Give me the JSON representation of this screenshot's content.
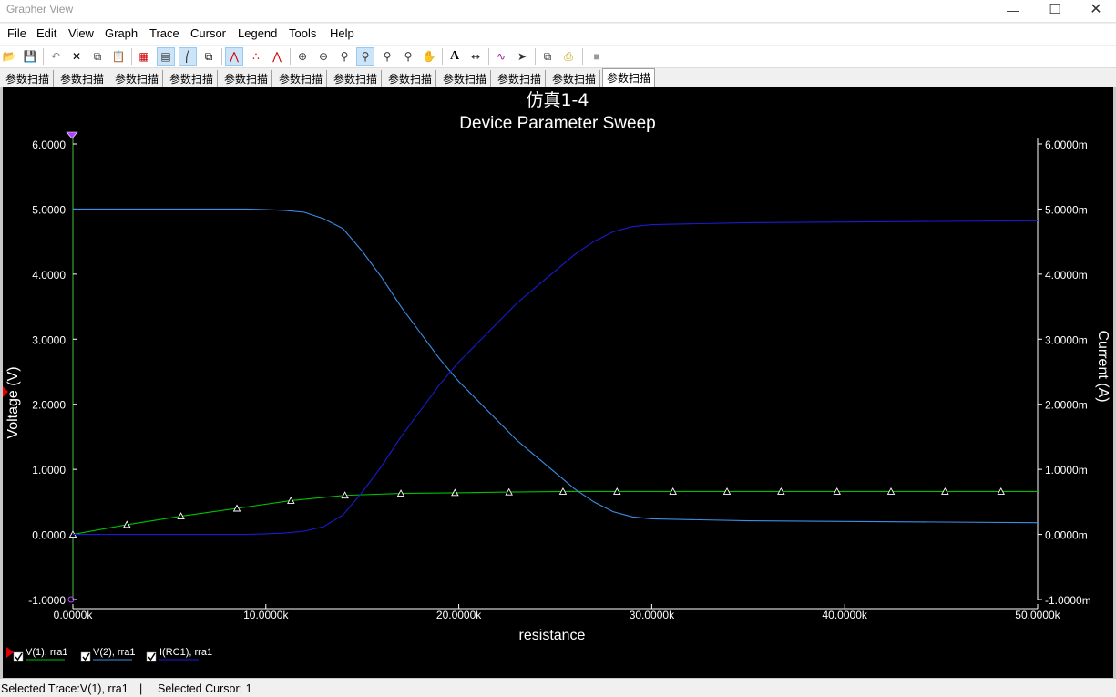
{
  "window": {
    "title": "Grapher View",
    "controls": {
      "minimize": "—",
      "maximize": "☐",
      "close": "✕"
    }
  },
  "menu": [
    "File",
    "Edit",
    "View",
    "Graph",
    "Trace",
    "Cursor",
    "Legend",
    "Tools",
    "Help"
  ],
  "toolbar": {
    "icons": [
      "open-icon",
      "save-icon",
      "undo-icon",
      "delete-icon",
      "copy-icon",
      "paste-icon",
      "grid-icon",
      "legend-icon",
      "cursors-icon",
      "overlay-icon",
      "line-trace-icon",
      "points-icon",
      "markers-icon",
      "zoom-in-icon",
      "zoom-out-icon",
      "zoom-area-icon",
      "zoom-full-icon",
      "zoom-x-icon",
      "zoom-y-icon",
      "pan-hand-icon",
      "text-icon",
      "draw-icon",
      "trace-props-icon",
      "export-icon",
      "copy-graph-icon",
      "print-icon",
      "stop-icon"
    ]
  },
  "tabs": [
    "参数扫描",
    "参数扫描",
    "参数扫描",
    "参数扫描",
    "参数扫描",
    "参数扫描",
    "参数扫描",
    "参数扫描",
    "参数扫描",
    "参数扫描",
    "参数扫描",
    "参数扫描"
  ],
  "active_tab": 11,
  "colors": {
    "background": "#000000",
    "v1": "#00c000",
    "v2": "#3b8fe8",
    "irc1": "#1a1ad6",
    "axis": "#ffffff"
  },
  "chart_data": {
    "type": "line",
    "title": "仿真1-4",
    "subtitle": "Device Parameter Sweep",
    "xlabel": "resistance",
    "ylabel_left": "Voltage (V)",
    "ylabel_right": "Current (A)",
    "xlim": [
      0,
      50000
    ],
    "ylim_left": [
      -1,
      6
    ],
    "ylim_right": [
      -0.001,
      0.006
    ],
    "x_ticks": [
      "0.0000k",
      "10.0000k",
      "20.0000k",
      "30.0000k",
      "40.0000k",
      "50.0000k"
    ],
    "y_ticks_left": [
      "6.0000",
      "5.0000",
      "4.0000",
      "3.0000",
      "2.0000",
      "1.0000",
      "0.0000",
      "-1.0000"
    ],
    "y_ticks_right": [
      "6.0000m",
      "5.0000m",
      "4.0000m",
      "3.0000m",
      "2.0000m",
      "1.0000m",
      "0.0000m",
      "-1.0000m"
    ],
    "grid": false,
    "legend_position": "bottom-left",
    "series": [
      {
        "name": "V(1), rra1",
        "axis": "left",
        "marker": "triangle",
        "x": [
          0,
          2800,
          5600,
          8500,
          11300,
          14100,
          17000,
          19800,
          22600,
          25400,
          28200,
          31100,
          33900,
          36700,
          39600,
          42400,
          45200,
          48100,
          50000
        ],
        "y": [
          0.0,
          0.15,
          0.28,
          0.4,
          0.52,
          0.6,
          0.63,
          0.64,
          0.65,
          0.66,
          0.66,
          0.66,
          0.66,
          0.66,
          0.66,
          0.66,
          0.66,
          0.66,
          0.66
        ]
      },
      {
        "name": "V(2), rra1",
        "axis": "left",
        "x": [
          0,
          5000,
          9000,
          10000,
          11000,
          12000,
          13000,
          14000,
          15000,
          16000,
          17000,
          18000,
          19000,
          20000,
          21000,
          22000,
          23000,
          24000,
          25000,
          26000,
          27000,
          28000,
          29000,
          30000,
          35000,
          40000,
          45000,
          50000
        ],
        "y": [
          5.0,
          5.0,
          5.0,
          4.99,
          4.98,
          4.95,
          4.85,
          4.7,
          4.35,
          3.95,
          3.5,
          3.1,
          2.7,
          2.35,
          2.05,
          1.75,
          1.45,
          1.2,
          0.95,
          0.7,
          0.5,
          0.35,
          0.27,
          0.24,
          0.21,
          0.2,
          0.19,
          0.18
        ]
      },
      {
        "name": "I(RC1), rra1",
        "axis": "right",
        "x": [
          0,
          5000,
          9000,
          10000,
          11000,
          12000,
          13000,
          14000,
          15000,
          16000,
          17000,
          18000,
          19000,
          20000,
          21000,
          22000,
          23000,
          24000,
          25000,
          26000,
          27000,
          28000,
          29000,
          30000,
          35000,
          40000,
          45000,
          50000
        ],
        "y": [
          0.0,
          0.0,
          0.0,
          1e-05,
          2e-05,
          5e-05,
          0.00012,
          0.0003,
          0.00065,
          0.00105,
          0.0015,
          0.0019,
          0.0023,
          0.00265,
          0.00295,
          0.00325,
          0.00355,
          0.0038,
          0.00405,
          0.0043,
          0.0045,
          0.00465,
          0.00473,
          0.00476,
          0.00479,
          0.0048,
          0.00481,
          0.00482
        ]
      }
    ]
  },
  "status": {
    "selected_trace": "Selected Trace:V(1), rra1",
    "divider": "|",
    "selected_cursor": "Selected Cursor: 1"
  }
}
